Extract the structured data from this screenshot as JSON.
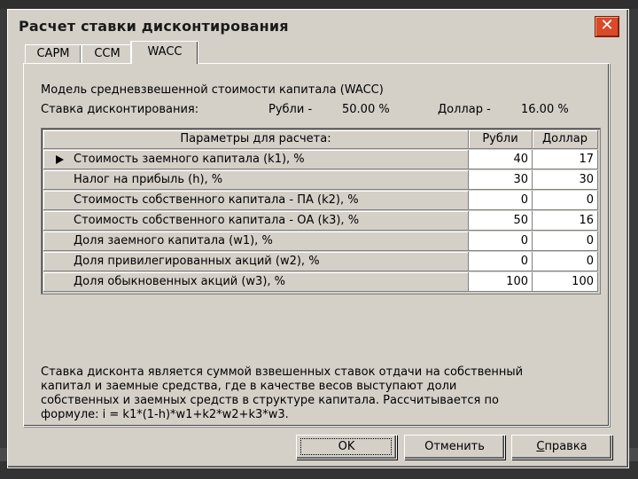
{
  "window": {
    "title": "Расчет ставки дисконтирования",
    "close_glyph": "✕"
  },
  "tabs": [
    {
      "label": "CAPM",
      "active": false
    },
    {
      "label": "CCM",
      "active": false
    },
    {
      "label": "WACC",
      "active": true
    }
  ],
  "model_title": "Модель средневзвешенной стоимости капитала (WACC)",
  "rate": {
    "label": "Ставка дисконтирования:",
    "rub_label": "Рубли -",
    "rub_value": "50.00 %",
    "usd_label": "Доллар -",
    "usd_value": "16.00 %"
  },
  "grid": {
    "headers": [
      "Параметры для расчета:",
      "Рубли",
      "Доллар"
    ],
    "rows": [
      {
        "name": "Стоимость заемного капитала (k1), %",
        "rub": "40",
        "usd": "17",
        "current": true
      },
      {
        "name": "Налог на прибыль (h), %",
        "rub": "30",
        "usd": "30"
      },
      {
        "name": "Стоимость собственного капитала - ПА (k2), %",
        "rub": "0",
        "usd": "0"
      },
      {
        "name": "Стоимость собственного капитала - ОА (k3), %",
        "rub": "50",
        "usd": "16"
      },
      {
        "name": "Доля заемного капитала (w1), %",
        "rub": "0",
        "usd": "0"
      },
      {
        "name": "Доля привилегированных акций (w2), %",
        "rub": "0",
        "usd": "0"
      },
      {
        "name": "Доля обыкновенных акций (w3), %",
        "rub": "100",
        "usd": "100"
      }
    ]
  },
  "description": "Ставка дисконта является суммой взвешенных ставок отдачи на собственный\nкапитал и заемные средства, где в качестве весов выступают доли\nсобственных и заемных средств в структуре капитала. Рассчитывается по\nформуле: i = k1*(1-h)*w1+k2*w2+k3*w3.",
  "buttons": {
    "ok": "OK",
    "cancel": "Отменить",
    "help_first": "С",
    "help_rest": "правка"
  },
  "colors": {
    "close_button": "#d94a2a",
    "face": "#d4d0c8"
  }
}
